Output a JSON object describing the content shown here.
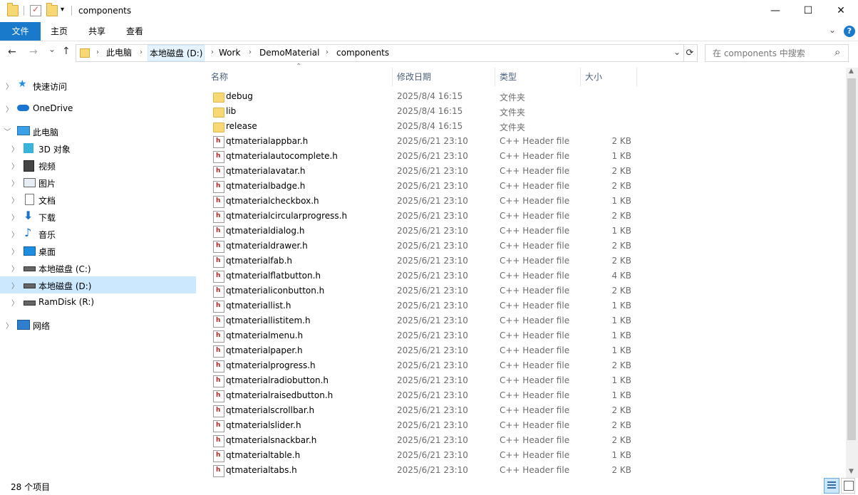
{
  "window": {
    "title": "components",
    "minimize": "—",
    "maximize": "☐",
    "close": "✕"
  },
  "ribbon": {
    "tabs": [
      "文件",
      "主页",
      "共享",
      "查看"
    ]
  },
  "nav": {
    "back": "←",
    "forward": "→",
    "recent": "⌄",
    "up": "↑",
    "breadcrumbs": [
      "此电脑",
      "本地磁盘 (D:)",
      "Work",
      "DemoMaterial",
      "components"
    ],
    "refresh": "⟳",
    "search_placeholder": "在 components 中搜索",
    "search_icon": "⌕"
  },
  "sidebar": {
    "items": [
      {
        "label": "快速访问",
        "icon": "star-icon"
      },
      {
        "label": "OneDrive",
        "icon": "cloud-icon"
      },
      {
        "label": "此电脑",
        "icon": "computer-icon"
      },
      {
        "label": "3D 对象",
        "icon": "cube-icon"
      },
      {
        "label": "视频",
        "icon": "video-icon"
      },
      {
        "label": "图片",
        "icon": "picture-icon"
      },
      {
        "label": "文档",
        "icon": "document-icon"
      },
      {
        "label": "下载",
        "icon": "download-icon"
      },
      {
        "label": "音乐",
        "icon": "music-icon"
      },
      {
        "label": "桌面",
        "icon": "desktop-icon"
      },
      {
        "label": "本地磁盘 (C:)",
        "icon": "drive-icon"
      },
      {
        "label": "本地磁盘 (D:)",
        "icon": "drive-icon",
        "selected": true
      },
      {
        "label": "RamDisk (R:)",
        "icon": "drive-icon"
      },
      {
        "label": "网络",
        "icon": "network-icon"
      }
    ]
  },
  "filelist": {
    "columns": [
      "名称",
      "修改日期",
      "类型",
      "大小"
    ],
    "files": [
      {
        "name": "debug",
        "date": "2025/8/4 16:15",
        "type": "文件夹",
        "size": "",
        "kind": "folder"
      },
      {
        "name": "lib",
        "date": "2025/8/4 16:15",
        "type": "文件夹",
        "size": "",
        "kind": "folder"
      },
      {
        "name": "release",
        "date": "2025/8/4 16:15",
        "type": "文件夹",
        "size": "",
        "kind": "folder"
      },
      {
        "name": "qtmaterialappbar.h",
        "date": "2025/6/21 23:10",
        "type": "C++ Header file",
        "size": "2 KB",
        "kind": "header"
      },
      {
        "name": "qtmaterialautocomplete.h",
        "date": "2025/6/21 23:10",
        "type": "C++ Header file",
        "size": "1 KB",
        "kind": "header"
      },
      {
        "name": "qtmaterialavatar.h",
        "date": "2025/6/21 23:10",
        "type": "C++ Header file",
        "size": "2 KB",
        "kind": "header"
      },
      {
        "name": "qtmaterialbadge.h",
        "date": "2025/6/21 23:10",
        "type": "C++ Header file",
        "size": "2 KB",
        "kind": "header"
      },
      {
        "name": "qtmaterialcheckbox.h",
        "date": "2025/6/21 23:10",
        "type": "C++ Header file",
        "size": "1 KB",
        "kind": "header"
      },
      {
        "name": "qtmaterialcircularprogress.h",
        "date": "2025/6/21 23:10",
        "type": "C++ Header file",
        "size": "2 KB",
        "kind": "header"
      },
      {
        "name": "qtmaterialdialog.h",
        "date": "2025/6/21 23:10",
        "type": "C++ Header file",
        "size": "1 KB",
        "kind": "header"
      },
      {
        "name": "qtmaterialdrawer.h",
        "date": "2025/6/21 23:10",
        "type": "C++ Header file",
        "size": "2 KB",
        "kind": "header"
      },
      {
        "name": "qtmaterialfab.h",
        "date": "2025/6/21 23:10",
        "type": "C++ Header file",
        "size": "2 KB",
        "kind": "header"
      },
      {
        "name": "qtmaterialflatbutton.h",
        "date": "2025/6/21 23:10",
        "type": "C++ Header file",
        "size": "4 KB",
        "kind": "header"
      },
      {
        "name": "qtmaterialiconbutton.h",
        "date": "2025/6/21 23:10",
        "type": "C++ Header file",
        "size": "2 KB",
        "kind": "header"
      },
      {
        "name": "qtmateriallist.h",
        "date": "2025/6/21 23:10",
        "type": "C++ Header file",
        "size": "1 KB",
        "kind": "header"
      },
      {
        "name": "qtmateriallistitem.h",
        "date": "2025/6/21 23:10",
        "type": "C++ Header file",
        "size": "1 KB",
        "kind": "header"
      },
      {
        "name": "qtmaterialmenu.h",
        "date": "2025/6/21 23:10",
        "type": "C++ Header file",
        "size": "1 KB",
        "kind": "header"
      },
      {
        "name": "qtmaterialpaper.h",
        "date": "2025/6/21 23:10",
        "type": "C++ Header file",
        "size": "1 KB",
        "kind": "header"
      },
      {
        "name": "qtmaterialprogress.h",
        "date": "2025/6/21 23:10",
        "type": "C++ Header file",
        "size": "2 KB",
        "kind": "header"
      },
      {
        "name": "qtmaterialradiobutton.h",
        "date": "2025/6/21 23:10",
        "type": "C++ Header file",
        "size": "1 KB",
        "kind": "header"
      },
      {
        "name": "qtmaterialraisedbutton.h",
        "date": "2025/6/21 23:10",
        "type": "C++ Header file",
        "size": "1 KB",
        "kind": "header"
      },
      {
        "name": "qtmaterialscrollbar.h",
        "date": "2025/6/21 23:10",
        "type": "C++ Header file",
        "size": "2 KB",
        "kind": "header"
      },
      {
        "name": "qtmaterialslider.h",
        "date": "2025/6/21 23:10",
        "type": "C++ Header file",
        "size": "2 KB",
        "kind": "header"
      },
      {
        "name": "qtmaterialsnackbar.h",
        "date": "2025/6/21 23:10",
        "type": "C++ Header file",
        "size": "2 KB",
        "kind": "header"
      },
      {
        "name": "qtmaterialtable.h",
        "date": "2025/6/21 23:10",
        "type": "C++ Header file",
        "size": "1 KB",
        "kind": "header"
      },
      {
        "name": "qtmaterialtabs.h",
        "date": "2025/6/21 23:10",
        "type": "C++ Header file",
        "size": "2 KB",
        "kind": "header"
      }
    ]
  },
  "status": {
    "item_count": "28 个项目"
  },
  "colors": {
    "accent": "#1979ca",
    "selection": "#cce8ff"
  }
}
